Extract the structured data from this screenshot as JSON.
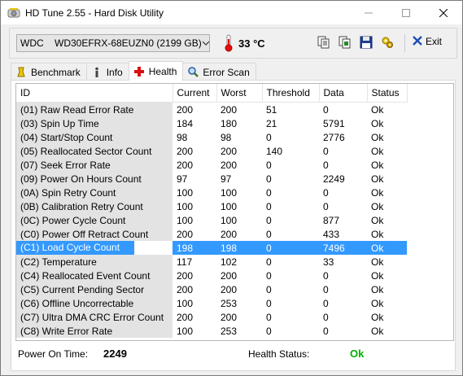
{
  "window": {
    "title": "HD Tune 2.55 - Hard Disk Utility"
  },
  "toolbar": {
    "drive": "WDC    WD30EFRX-68EUZN0 (2199 GB)",
    "temperature": "33 °C",
    "exit_label": "Exit"
  },
  "tabs": [
    {
      "label": "Benchmark",
      "icon": "stopwatch-icon"
    },
    {
      "label": "Info",
      "icon": "info-icon"
    },
    {
      "label": "Health",
      "icon": "health-cross-icon",
      "active": true
    },
    {
      "label": "Error Scan",
      "icon": "magnifier-icon"
    }
  ],
  "smart_table": {
    "columns": [
      "ID",
      "Current",
      "Worst",
      "Threshold",
      "Data",
      "Status"
    ],
    "rows": [
      [
        "(01) Raw Read Error Rate",
        "200",
        "200",
        "51",
        "0",
        "Ok"
      ],
      [
        "(03) Spin Up Time",
        "184",
        "180",
        "21",
        "5791",
        "Ok"
      ],
      [
        "(04) Start/Stop Count",
        "98",
        "98",
        "0",
        "2776",
        "Ok"
      ],
      [
        "(05) Reallocated Sector Count",
        "200",
        "200",
        "140",
        "0",
        "Ok"
      ],
      [
        "(07) Seek Error Rate",
        "200",
        "200",
        "0",
        "0",
        "Ok"
      ],
      [
        "(09) Power On Hours Count",
        "97",
        "97",
        "0",
        "2249",
        "Ok"
      ],
      [
        "(0A) Spin Retry Count",
        "100",
        "100",
        "0",
        "0",
        "Ok"
      ],
      [
        "(0B) Calibration Retry Count",
        "100",
        "100",
        "0",
        "0",
        "Ok"
      ],
      [
        "(0C) Power Cycle Count",
        "100",
        "100",
        "0",
        "877",
        "Ok"
      ],
      [
        "(C0) Power Off Retract Count",
        "200",
        "200",
        "0",
        "433",
        "Ok"
      ],
      [
        "(C1) Load Cycle Count",
        "198",
        "198",
        "0",
        "7496",
        "Ok"
      ],
      [
        "(C2) Temperature",
        "117",
        "102",
        "0",
        "33",
        "Ok"
      ],
      [
        "(C4) Reallocated Event Count",
        "200",
        "200",
        "0",
        "0",
        "Ok"
      ],
      [
        "(C5) Current Pending Sector",
        "200",
        "200",
        "0",
        "0",
        "Ok"
      ],
      [
        "(C6) Offline Uncorrectable",
        "100",
        "253",
        "0",
        "0",
        "Ok"
      ],
      [
        "(C7) Ultra DMA CRC Error Count",
        "200",
        "200",
        "0",
        "0",
        "Ok"
      ],
      [
        "(C8) Write Error Rate",
        "100",
        "253",
        "0",
        "0",
        "Ok"
      ]
    ],
    "selected_row": 10
  },
  "footer": {
    "power_on_label": "Power On Time:",
    "power_on_value": "2249",
    "health_label": "Health Status:",
    "health_value": "Ok",
    "health_color": "#00b000"
  },
  "colors": {
    "selection": "#3399ff",
    "id_column": "#e3e3e3"
  }
}
